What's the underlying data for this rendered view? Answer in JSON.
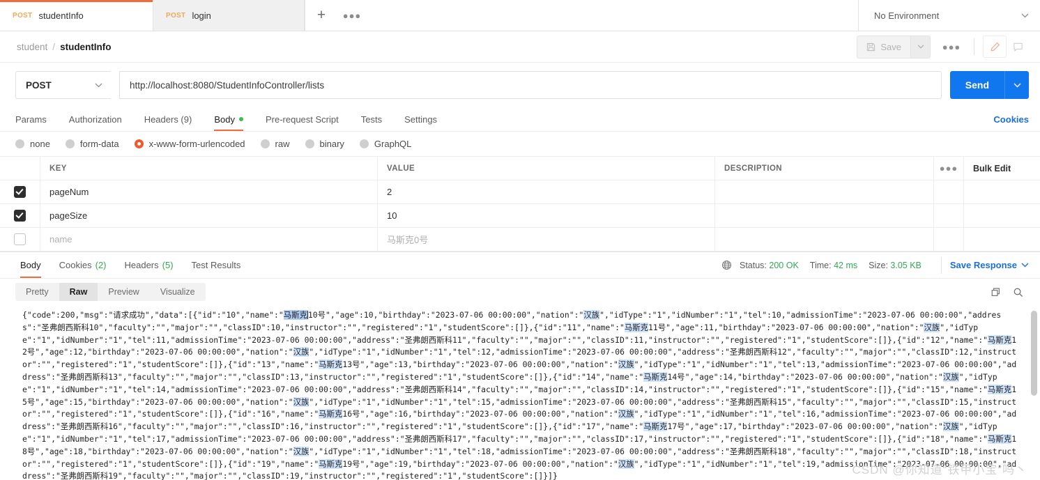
{
  "tabstrip": {
    "tabs": [
      {
        "method": "POST",
        "name": "studentInfo",
        "active": true
      },
      {
        "method": "POST",
        "name": "login",
        "active": false
      }
    ],
    "new_tab_icon": "plus-icon",
    "more_icon": "ellipsis-icon",
    "environment": "No Environment"
  },
  "breadcrumb": {
    "collection": "student",
    "separator": "/",
    "request": "studentInfo",
    "save_label": "Save",
    "save_icon": "floppy-disk-icon",
    "caret_icon": "chevron-down-icon",
    "more_icon": "ellipsis-icon",
    "edit_icon": "pencil-icon",
    "comment_icon": "comment-icon"
  },
  "url_row": {
    "method": "POST",
    "method_caret": "chevron-down-icon",
    "url": "http://localhost:8080/StudentInfoController/lists",
    "send_label": "Send",
    "send_caret": "chevron-down-icon"
  },
  "request_tabs": {
    "items": [
      {
        "label": "Params",
        "active": false,
        "dot": false
      },
      {
        "label": "Authorization",
        "active": false,
        "dot": false
      },
      {
        "label": "Headers (9)",
        "active": false,
        "dot": false
      },
      {
        "label": "Body",
        "active": true,
        "dot": true
      },
      {
        "label": "Pre-request Script",
        "active": false,
        "dot": false
      },
      {
        "label": "Tests",
        "active": false,
        "dot": false
      },
      {
        "label": "Settings",
        "active": false,
        "dot": false
      }
    ],
    "cookies_link": "Cookies"
  },
  "body_types": [
    {
      "label": "none",
      "selected": false
    },
    {
      "label": "form-data",
      "selected": false
    },
    {
      "label": "x-www-form-urlencoded",
      "selected": true
    },
    {
      "label": "raw",
      "selected": false
    },
    {
      "label": "binary",
      "selected": false
    },
    {
      "label": "GraphQL",
      "selected": false
    }
  ],
  "params_table": {
    "columns": {
      "key": "KEY",
      "value": "VALUE",
      "description": "DESCRIPTION"
    },
    "more_icon": "ellipsis-icon",
    "bulk_edit": "Bulk Edit",
    "rows": [
      {
        "checked": true,
        "key": "pageNum",
        "value": "2",
        "description": "",
        "placeholder": false
      },
      {
        "checked": true,
        "key": "pageSize",
        "value": "10",
        "description": "",
        "placeholder": false
      },
      {
        "checked": false,
        "key": "name",
        "value": "马斯克0号",
        "description": "",
        "placeholder": true
      }
    ]
  },
  "response": {
    "tabs": [
      {
        "label": "Body",
        "count": "",
        "active": true
      },
      {
        "label": "Cookies",
        "count": "(2)",
        "active": false
      },
      {
        "label": "Headers",
        "count": "(5)",
        "active": false
      },
      {
        "label": "Test Results",
        "count": "",
        "active": false
      }
    ],
    "globe_icon": "globe-icon",
    "status_label": "Status:",
    "status_value": "200 OK",
    "time_label": "Time:",
    "time_value": "42 ms",
    "size_label": "Size:",
    "size_value": "3.05 KB",
    "save_response": "Save Response",
    "save_response_caret": "chevron-down-icon",
    "view_modes": [
      {
        "label": "Pretty",
        "active": false
      },
      {
        "label": "Raw",
        "active": true
      },
      {
        "label": "Preview",
        "active": false
      },
      {
        "label": "Visualize",
        "active": false
      }
    ],
    "copy_icon": "copy-icon",
    "search_icon": "search-icon",
    "body_text": "{\"code\":200,\"msg\":\"请求成功\",\"data\":[{\"id\":\"10\",\"name\":\"马斯克10号\",\"age\":10,\"birthday\":\"2023-07-06 00:00:00\",\"nation\":\"汉族\",\"idType\":\"1\",\"idNumber\":\"1\",\"tel\":10,\"admissionTime\":\"2023-07-06 00:00:00\",\"address\":\"圣弗朗西斯科10\",\"faculty\":\"\",\"major\":\"\",\"classID\":10,\"instructor\":\"\",\"registered\":\"1\",\"studentScore\":[]},{\"id\":\"11\",\"name\":\"马斯克11号\",\"age\":11,\"birthday\":\"2023-07-06 00:00:00\",\"nation\":\"汉族\",\"idType\":\"1\",\"idNumber\":\"1\",\"tel\":11,\"admissionTime\":\"2023-07-06 00:00:00\",\"address\":\"圣弗朗西斯科11\",\"faculty\":\"\",\"major\":\"\",\"classID\":11,\"instructor\":\"\",\"registered\":\"1\",\"studentScore\":[]},{\"id\":\"12\",\"name\":\"马斯克12号\",\"age\":12,\"birthday\":\"2023-07-06 00:00:00\",\"nation\":\"汉族\",\"idType\":\"1\",\"idNumber\":\"1\",\"tel\":12,\"admissionTime\":\"2023-07-06 00:00:00\",\"address\":\"圣弗朗西斯科12\",\"faculty\":\"\",\"major\":\"\",\"classID\":12,\"instructor\":\"\",\"registered\":\"1\",\"studentScore\":[]},{\"id\":\"13\",\"name\":\"马斯克13号\",\"age\":13,\"birthday\":\"2023-07-06 00:00:00\",\"nation\":\"汉族\",\"idType\":\"1\",\"idNumber\":\"1\",\"tel\":13,\"admissionTime\":\"2023-07-06 00:00:00\",\"address\":\"圣弗朗西斯科13\",\"faculty\":\"\",\"major\":\"\",\"classID\":13,\"instructor\":\"\",\"registered\":\"1\",\"studentScore\":[]},{\"id\":\"14\",\"name\":\"马斯克14号\",\"age\":14,\"birthday\":\"2023-07-06 00:00:00\",\"nation\":\"汉族\",\"idType\":\"1\",\"idNumber\":\"1\",\"tel\":14,\"admissionTime\":\"2023-07-06 00:00:00\",\"address\":\"圣弗朗西斯科14\",\"faculty\":\"\",\"major\":\"\",\"classID\":14,\"instructor\":\"\",\"registered\":\"1\",\"studentScore\":[]},{\"id\":\"15\",\"name\":\"马斯克15号\",\"age\":15,\"birthday\":\"2023-07-06 00:00:00\",\"nation\":\"汉族\",\"idType\":\"1\",\"idNumber\":\"1\",\"tel\":15,\"admissionTime\":\"2023-07-06 00:00:00\",\"address\":\"圣弗朗西斯科15\",\"faculty\":\"\",\"major\":\"\",\"classID\":15,\"instructor\":\"\",\"registered\":\"1\",\"studentScore\":[]},{\"id\":\"16\",\"name\":\"马斯克16号\",\"age\":16,\"birthday\":\"2023-07-06 00:00:00\",\"nation\":\"汉族\",\"idType\":\"1\",\"idNumber\":\"1\",\"tel\":16,\"admissionTime\":\"2023-07-06 00:00:00\",\"address\":\"圣弗朗西斯科16\",\"faculty\":\"\",\"major\":\"\",\"classID\":16,\"instructor\":\"\",\"registered\":\"1\",\"studentScore\":[]},{\"id\":\"17\",\"name\":\"马斯克17号\",\"age\":17,\"birthday\":\"2023-07-06 00:00:00\",\"nation\":\"汉族\",\"idType\":\"1\",\"idNumber\":\"1\",\"tel\":17,\"admissionTime\":\"2023-07-06 00:00:00\",\"address\":\"圣弗朗西斯科17\",\"faculty\":\"\",\"major\":\"\",\"classID\":17,\"instructor\":\"\",\"registered\":\"1\",\"studentScore\":[]},{\"id\":\"18\",\"name\":\"马斯克18号\",\"age\":18,\"birthday\":\"2023-07-06 00:00:00\",\"nation\":\"汉族\",\"idType\":\"1\",\"idNumber\":\"1\",\"tel\":18,\"admissionTime\":\"2023-07-06 00:00:00\",\"address\":\"圣弗朗西斯科18\",\"faculty\":\"\",\"major\":\"\",\"classID\":18,\"instructor\":\"\",\"registered\":\"1\",\"studentScore\":[]},{\"id\":\"19\",\"name\":\"马斯克19号\",\"age\":19,\"birthday\":\"2023-07-06 00:00:00\",\"nation\":\"汉族\",\"idType\":\"1\",\"idNumber\":\"1\",\"tel\":19,\"admissionTime\":\"2023-07-06 00:00:00\",\"address\":\"圣弗朗西斯科19\",\"faculty\":\"\",\"major\":\"\",\"classID\":19,\"instructor\":\"\",\"registered\":\"1\",\"studentScore\":[]}]}"
  },
  "watermark": "CSDN @你知道“铁甲小宝”吗丶",
  "colors": {
    "accent_orange": "#f26b3a",
    "send_blue": "#1177ee",
    "link_blue": "#1a6fe0",
    "status_green": "#35a657",
    "method_post": "#eea95c"
  }
}
